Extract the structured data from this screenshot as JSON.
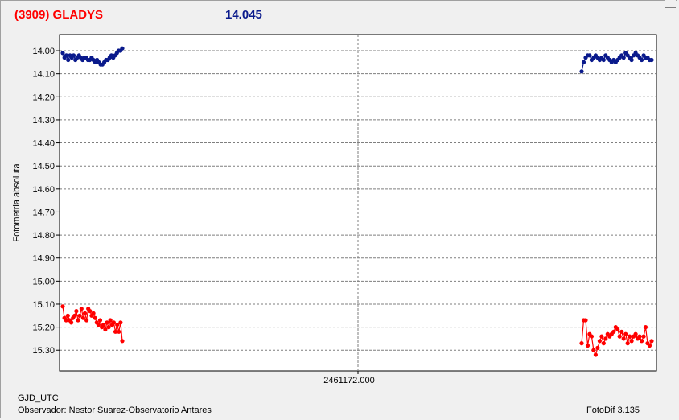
{
  "header": {
    "object_name": "(3909) GLADYS",
    "reference_magnitude": "14.045"
  },
  "footer": {
    "x_axis_name": "GJD_UTC",
    "observer": "Observador: Nestor Suarez-Observatorio Antares",
    "software": "FotoDif 3.135"
  },
  "colors": {
    "blue_series": "#0a1a8c",
    "red_series": "#ff0000",
    "grid": "#7f7f7f"
  },
  "chart_data": {
    "type": "scatter",
    "ylabel": "Fotometria absoluta",
    "xlabel": "GJD_UTC",
    "x_center_label": "2461172.000",
    "ylim": [
      13.93,
      15.39
    ],
    "y_inverted": true,
    "yticks": [
      "14.00",
      "14.10",
      "14.20",
      "14.30",
      "14.40",
      "14.50",
      "14.60",
      "14.70",
      "14.80",
      "14.90",
      "15.00",
      "15.10",
      "15.20",
      "15.30"
    ],
    "grid": true,
    "series": [
      {
        "color": "blue",
        "segments": [
          [
            14.01,
            14.03,
            14.02,
            14.04,
            14.02,
            14.03,
            14.02,
            14.04,
            14.03,
            14.02,
            14.03,
            14.04,
            14.03,
            14.03,
            14.04,
            14.04,
            14.03,
            14.04,
            14.05,
            14.04,
            14.05,
            14.06,
            14.06,
            14.05,
            14.04,
            14.04,
            14.03,
            14.02,
            14.03,
            14.02,
            14.01,
            14.0,
            14.0,
            13.99
          ],
          [
            14.09,
            14.05,
            14.03,
            14.02,
            14.02,
            14.04,
            14.03,
            14.02,
            14.03,
            14.04,
            14.03,
            14.04,
            14.02,
            14.03,
            14.04,
            14.05,
            14.04,
            14.05,
            14.04,
            14.03,
            14.02,
            14.03,
            14.01,
            14.02,
            14.03,
            14.04,
            14.02,
            14.01,
            14.02,
            14.03,
            14.04,
            14.02,
            14.03,
            14.03,
            14.04,
            14.04
          ]
        ]
      },
      {
        "color": "red",
        "segments": [
          [
            15.11,
            15.16,
            15.17,
            15.15,
            15.17,
            15.18,
            15.16,
            15.15,
            15.13,
            15.17,
            15.15,
            15.12,
            15.16,
            15.14,
            15.17,
            15.12,
            15.13,
            15.15,
            15.14,
            15.16,
            15.18,
            15.19,
            15.17,
            15.2,
            15.19,
            15.21,
            15.18,
            15.2,
            15.17,
            15.19,
            15.18,
            15.22,
            15.19,
            15.22,
            15.18,
            15.26
          ],
          [
            15.27,
            15.17,
            15.17,
            15.28,
            15.23,
            15.24,
            15.3,
            15.32,
            15.29,
            15.26,
            15.24,
            15.27,
            15.25,
            15.23,
            15.24,
            15.23,
            15.22,
            15.2,
            15.21,
            15.24,
            15.22,
            15.25,
            15.23,
            15.27,
            15.24,
            15.26,
            15.24,
            15.23,
            15.25,
            15.24,
            15.26,
            15.24,
            15.2,
            15.27,
            15.28,
            15.26
          ]
        ]
      }
    ]
  }
}
